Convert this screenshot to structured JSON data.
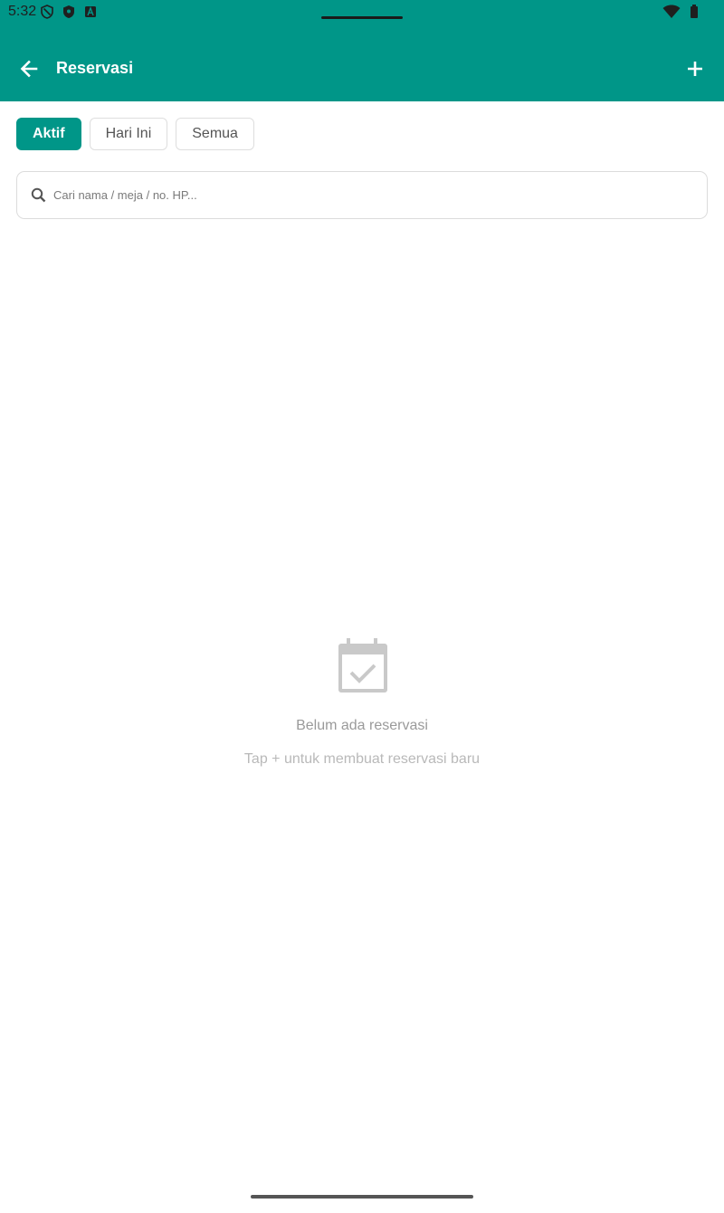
{
  "status_bar": {
    "time": "5:32",
    "left_icons": [
      "vpn-shield-icon",
      "security-shield-icon",
      "font-a-icon"
    ],
    "right_icons": [
      "wifi-icon",
      "battery-icon"
    ]
  },
  "app_bar": {
    "title": "Reservasi",
    "back_icon": "arrow-left-icon",
    "add_icon": "plus-icon",
    "color": "#009688"
  },
  "filters": {
    "selected": "Aktif",
    "items": [
      {
        "label": "Aktif"
      },
      {
        "label": "Hari Ini"
      },
      {
        "label": "Semua"
      }
    ]
  },
  "search": {
    "placeholder": "Cari nama / meja / no. HP...",
    "value": ""
  },
  "empty_state": {
    "icon": "calendar-check-icon",
    "title": "Belum ada reservasi",
    "subtitle": "Tap + untuk membuat reservasi baru"
  }
}
